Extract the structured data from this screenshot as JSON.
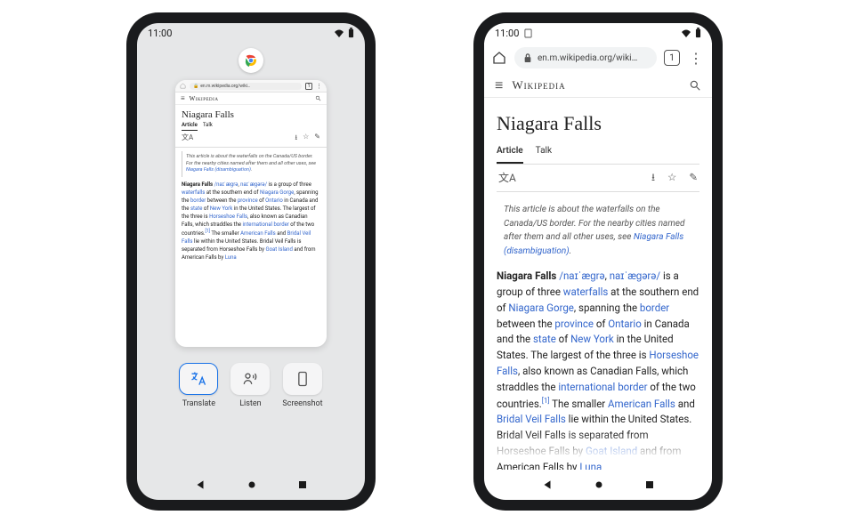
{
  "status": {
    "time": "11:00",
    "tab_count": "1"
  },
  "browser": {
    "url_short": "en.m.wikipedia.org/wiki…",
    "url_long": "en.m.wikipedia.org/wiki…"
  },
  "wiki": {
    "site": "Wikipedia",
    "title": "Niagara Falls",
    "tabs": {
      "article": "Article",
      "talk": "Talk"
    },
    "disambig_prefix": "This article is about the waterfalls on the Canada/US border. For the nearby cities named after them and all other uses, see ",
    "disambig_link": "Niagara Falls (disambiguation)",
    "disambig_suffix": ".",
    "p1": {
      "t0": "Niagara Falls ",
      "ipa1": "/naɪˈæɡrə",
      "ipa_sep": ", ",
      "ipa2": "naɪˈæɡərə/",
      "t1": " is a group of three ",
      "l1": "waterfalls",
      "t2": " at the southern end of ",
      "l2": "Niagara Gorge",
      "t3": ", spanning the ",
      "l3": "border",
      "t4": " between the ",
      "l4": "province",
      "t5": " of ",
      "l5": "Ontario",
      "t6": " in Canada and the ",
      "l6": "state",
      "t7": " of ",
      "l7": "New York",
      "t8": " in the United States. The largest of the three is ",
      "l8": "Horseshoe Falls",
      "t9": ", also known as Canadian Falls, which straddles the ",
      "l9": "international border",
      "t10": " of the two countries.",
      "ref": "[1]",
      "t11": " The smaller ",
      "l10": "American Falls",
      "t12": " and ",
      "l11": "Bridal Veil Falls",
      "t13": " lie within the United States. Bridal Veil Falls is separated from Horseshoe Falls by ",
      "l12": "Goat Island",
      "t14": " and from American Falls by ",
      "l13": "Luna"
    }
  },
  "overview_actions": {
    "translate": "Translate",
    "listen": "Listen",
    "screenshot": "Screenshot"
  }
}
